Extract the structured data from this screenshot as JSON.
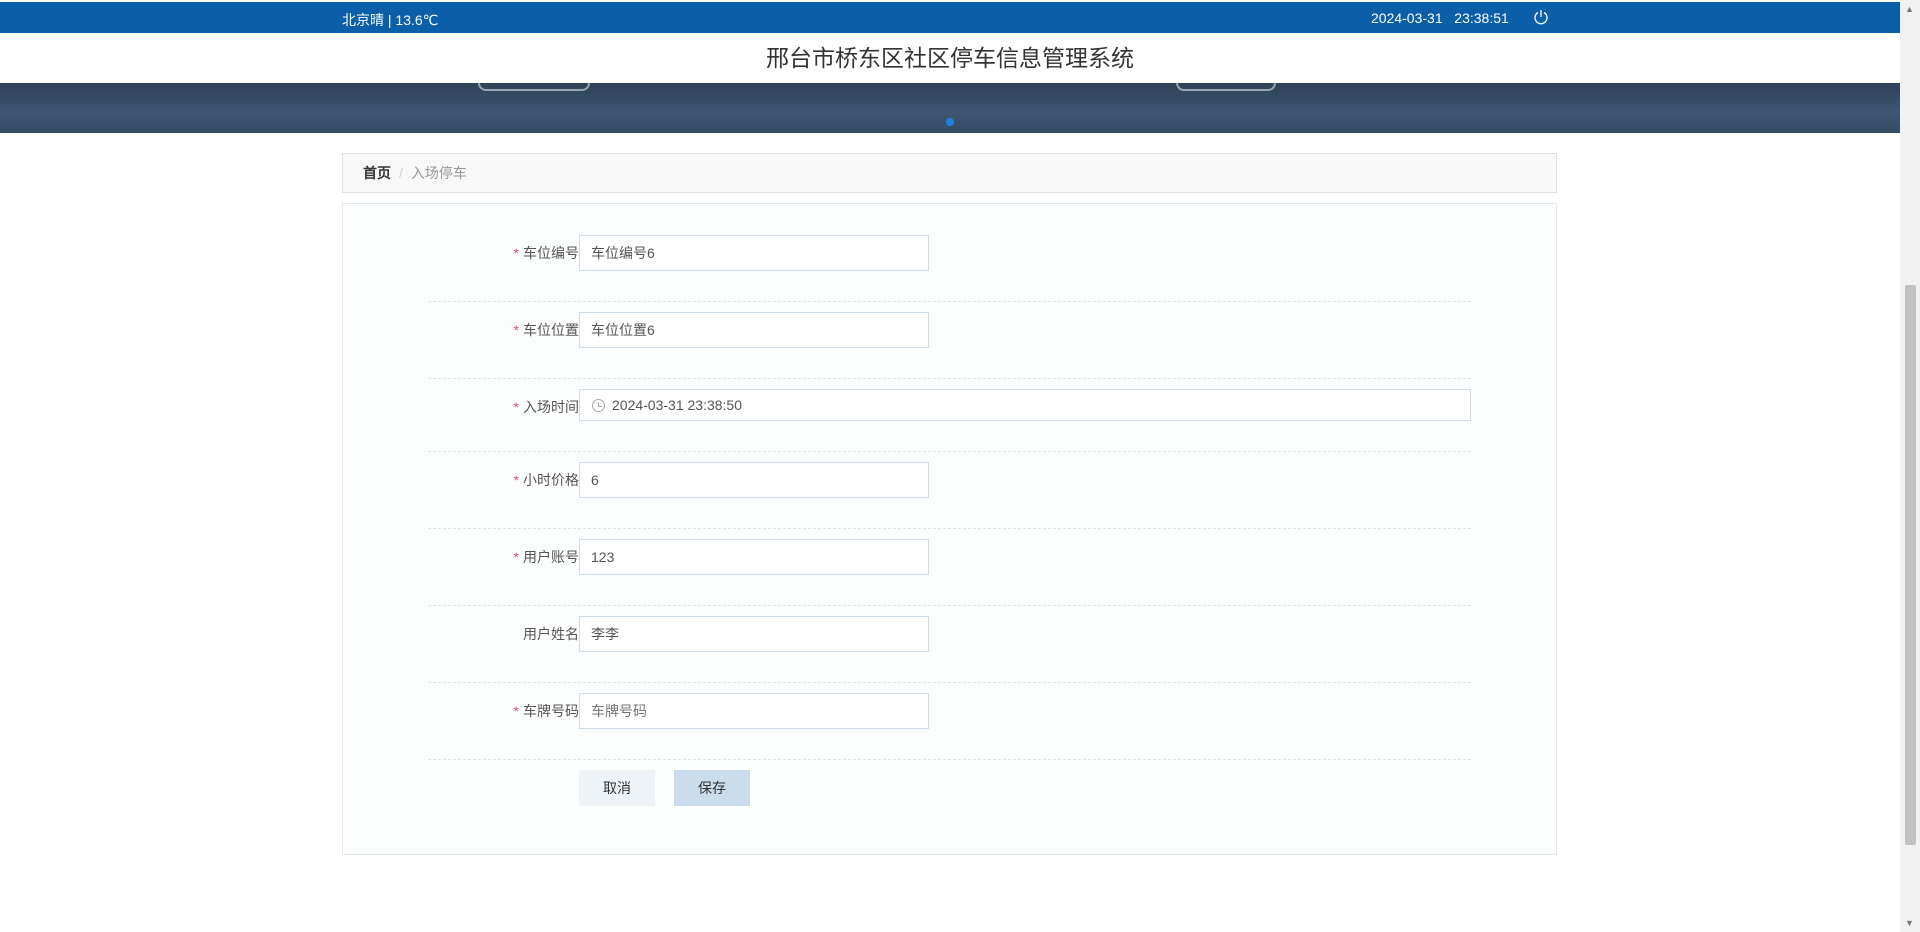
{
  "topbar": {
    "weather": "北京晴 | 13.6℃",
    "datetime": "2024-03-31   23:38:51"
  },
  "header": {
    "title": "邢台市桥东区社区停车信息管理系统"
  },
  "breadcrumb": {
    "home": "首页",
    "separator": "/",
    "current": "入场停车"
  },
  "form": {
    "fields": [
      {
        "label": "车位编号",
        "required": true,
        "value": "车位编号6",
        "placeholder": ""
      },
      {
        "label": "车位位置",
        "required": true,
        "value": "车位位置6",
        "placeholder": ""
      },
      {
        "label": "入场时间",
        "required": true,
        "value": "2024-03-31 23:38:50",
        "placeholder": ""
      },
      {
        "label": "小时价格",
        "required": true,
        "value": "6",
        "placeholder": ""
      },
      {
        "label": "用户账号",
        "required": true,
        "value": "123",
        "placeholder": ""
      },
      {
        "label": "用户姓名",
        "required": false,
        "value": "李李",
        "placeholder": ""
      },
      {
        "label": "车牌号码",
        "required": true,
        "value": "",
        "placeholder": "车牌号码"
      }
    ],
    "required_mark": "*",
    "cancel_label": "取消",
    "save_label": "保存"
  }
}
